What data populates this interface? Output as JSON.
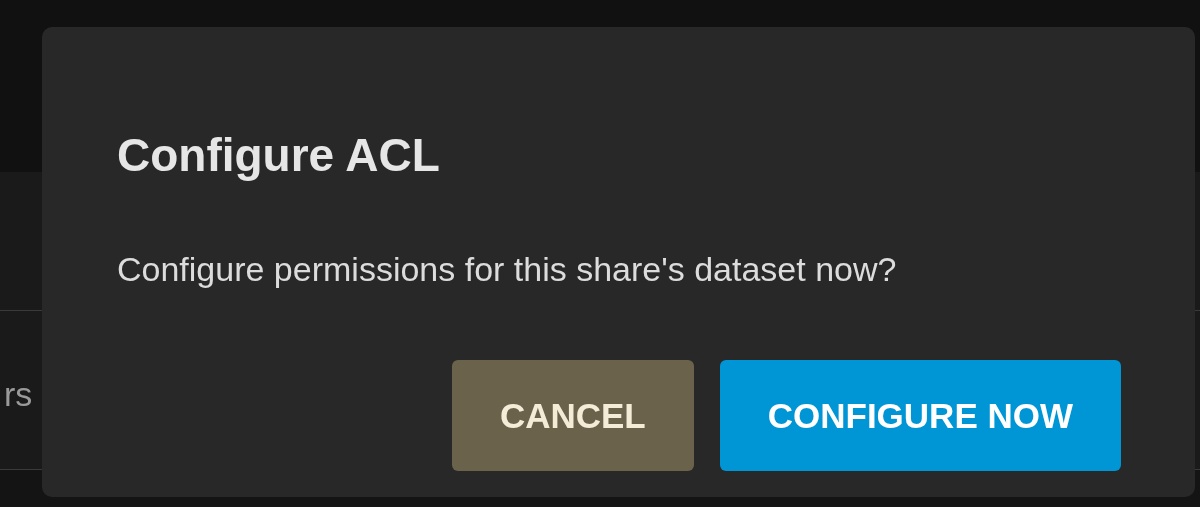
{
  "background": {
    "row_text": "rs"
  },
  "dialog": {
    "title": "Configure ACL",
    "message": "Configure permissions for this share's dataset now?",
    "buttons": [
      {
        "label": "CANCEL",
        "kind": "secondary"
      },
      {
        "label": "CONFIGURE NOW",
        "kind": "primary"
      }
    ]
  }
}
